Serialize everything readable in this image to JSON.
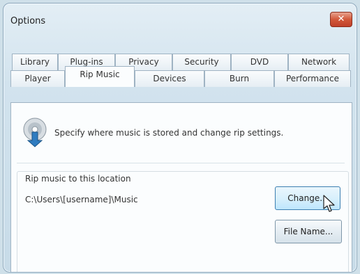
{
  "window": {
    "title": "Options",
    "close_label": "✕"
  },
  "tabs": {
    "row1": [
      {
        "label": "Library"
      },
      {
        "label": "Plug-ins"
      },
      {
        "label": "Privacy"
      },
      {
        "label": "Security"
      },
      {
        "label": "DVD"
      },
      {
        "label": "Network"
      }
    ],
    "row2": [
      {
        "label": "Player"
      },
      {
        "label": "Rip Music"
      },
      {
        "label": "Devices"
      },
      {
        "label": "Burn"
      },
      {
        "label": "Performance"
      }
    ],
    "active": "Rip Music"
  },
  "rip_music": {
    "description": "Specify where music is stored and change rip settings.",
    "location_group_label": "Rip music to this location",
    "location_path": "C:\\Users\\[username]\\Music",
    "change_button": "Change...",
    "file_name_button": "File Name..."
  },
  "colors": {
    "accent": "#3c7fb1",
    "close": "#c9482f"
  },
  "icons": {
    "rip": "cd-download-icon",
    "cursor": "mouse-pointer-icon"
  }
}
